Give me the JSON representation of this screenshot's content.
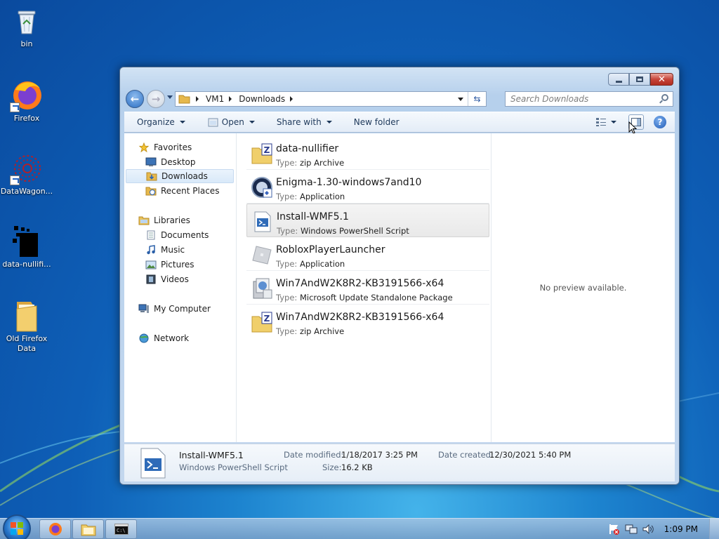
{
  "desktop": {
    "icons": [
      {
        "label": "bin",
        "icon": "recycle-bin-icon"
      },
      {
        "label": "Firefox",
        "icon": "firefox-icon"
      },
      {
        "label": "DataWagon...",
        "icon": "datawagon-icon"
      },
      {
        "label": "data-nullifi...",
        "icon": "data-nullifier-icon"
      },
      {
        "label": "Old Firefox Data",
        "icon": "folder-icon"
      }
    ]
  },
  "explorer": {
    "address": {
      "segments": [
        "VM1",
        "Downloads"
      ]
    },
    "search_placeholder": "Search Downloads",
    "toolbar": {
      "organize": "Organize",
      "open": "Open",
      "share_with": "Share with",
      "new_folder": "New folder"
    },
    "nav": {
      "favorites": "Favorites",
      "desktop": "Desktop",
      "downloads": "Downloads",
      "recent_places": "Recent Places",
      "libraries": "Libraries",
      "documents": "Documents",
      "music": "Music",
      "pictures": "Pictures",
      "videos": "Videos",
      "my_computer": "My Computer",
      "network": "Network"
    },
    "type_label": "Type:",
    "files": [
      {
        "name": "data-nullifier",
        "type": "zip Archive",
        "icon": "zip-folder-icon"
      },
      {
        "name": "Enigma-1.30-windows7and10",
        "type": "Application",
        "icon": "enigma-app-icon"
      },
      {
        "name": "Install-WMF5.1",
        "type": "Windows PowerShell Script",
        "icon": "powershell-script-icon",
        "selected": true
      },
      {
        "name": "RobloxPlayerLauncher",
        "type": "Application",
        "icon": "roblox-icon"
      },
      {
        "name": "Win7AndW2K8R2-KB3191566-x64",
        "type": "Microsoft Update Standalone Package",
        "icon": "msu-package-icon"
      },
      {
        "name": "Win7AndW2K8R2-KB3191566-x64",
        "type": "zip Archive",
        "icon": "zip-folder-icon"
      }
    ],
    "preview_text": "No preview available.",
    "details": {
      "name": "Install-WMF5.1",
      "type": "Windows PowerShell Script",
      "date_modified_label": "Date modified:",
      "date_modified": "1/18/2017 3:25 PM",
      "size_label": "Size:",
      "size": "16.2 KB",
      "date_created_label": "Date created:",
      "date_created": "12/30/2021 5:40 PM"
    }
  },
  "taskbar": {
    "buttons": [
      "firefox-icon",
      "explorer-folder-icon",
      "command-prompt-icon"
    ],
    "clock": "1:09 PM"
  }
}
